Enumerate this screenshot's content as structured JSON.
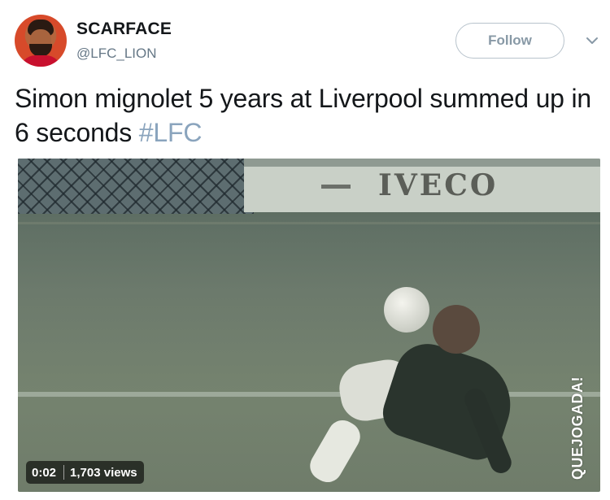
{
  "author": {
    "display_name": "SCARFACE",
    "handle": "@LFC_LION"
  },
  "actions": {
    "follow_label": "Follow",
    "menu_icon": "chevron-down-icon"
  },
  "tweet": {
    "text": "Simon mignolet 5 years at Liverpool summed up in 6 seconds",
    "hashtag": "#LFC"
  },
  "media": {
    "billboard_text": "IVECO",
    "watermark": "QUEJOGADA!",
    "duration": "0:02",
    "views": "1,703 views"
  },
  "colors": {
    "hashtag": "#8aa4bd",
    "handle": "#657786",
    "follow_border": "#b8c3cc"
  }
}
